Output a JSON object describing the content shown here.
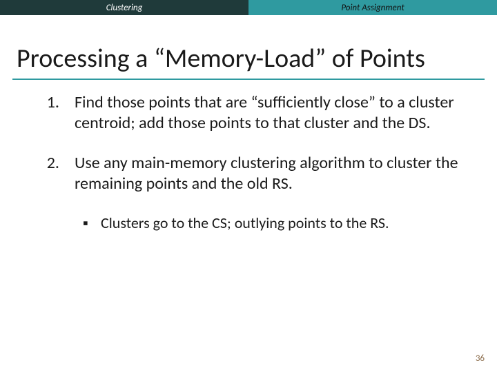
{
  "header": {
    "left_label": "Clustering",
    "right_label": "Point Assignment"
  },
  "title": "Processing a “Memory-Load” of Points",
  "items": [
    {
      "number": "1.",
      "text": "Find those points that are “sufficiently close” to a cluster centroid; add those points to that cluster and the DS."
    },
    {
      "number": "2.",
      "text": "Use any main-memory clustering algorithm to cluster the remaining points and the old RS.",
      "sub": [
        {
          "bullet": "▪",
          "text": "Clusters go to the CS; outlying points to the RS."
        }
      ]
    }
  ],
  "page_number": "36"
}
